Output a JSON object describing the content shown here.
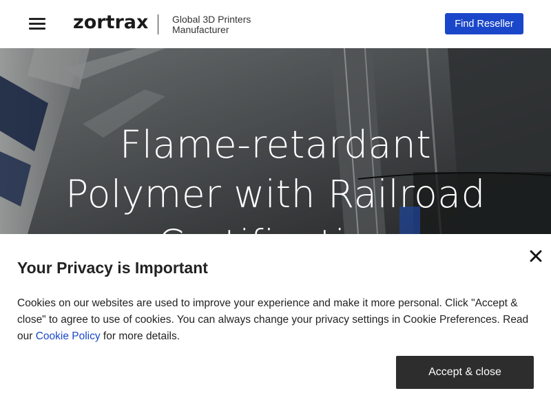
{
  "header": {
    "menu_icon": "hamburger-menu-icon",
    "logo_text": "zortrax",
    "tagline_line1": "Global 3D Printers",
    "tagline_line2": "Manufacturer",
    "find_reseller_label": "Find Reseller",
    "accent_color": "#1a47c9"
  },
  "hero": {
    "title_line1": "Flame-retardant",
    "title_line2": "Polymer with Railroad",
    "title_line3": "Certification"
  },
  "privacy_modal": {
    "title": "Your Privacy is Important",
    "close_icon": "close-icon",
    "text_before_link": "Cookies on our websites are used to improve your experience and make it more personal. Click \"Accept & close\" to agree to use of cookies. You can always change your privacy settings in Cookie Preferences. Read our ",
    "link_label": "Cookie Policy",
    "text_after_link": " for more details.",
    "accept_label": "Accept & close"
  }
}
